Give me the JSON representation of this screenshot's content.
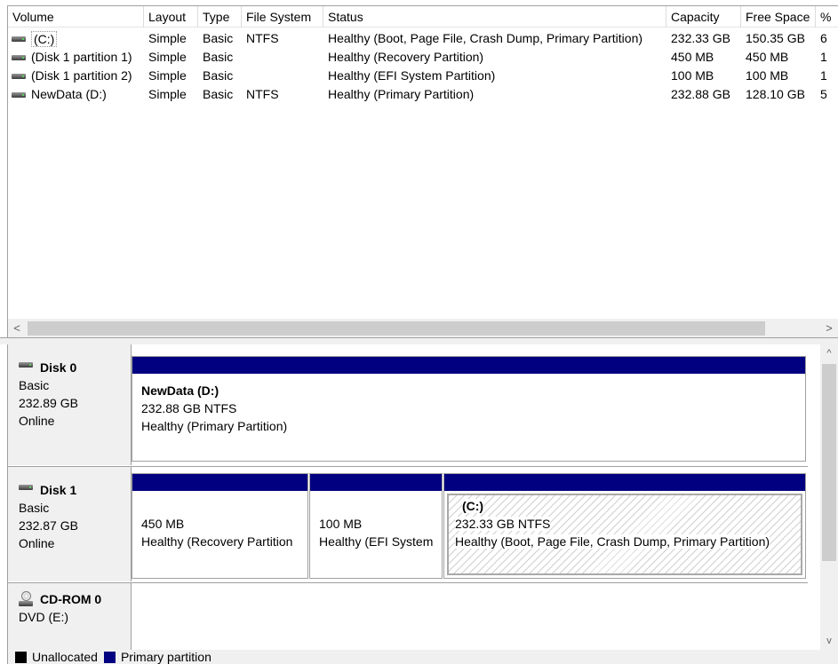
{
  "volume_list": {
    "columns": [
      "Volume",
      "Layout",
      "Type",
      "File System",
      "Status",
      "Capacity",
      "Free Space",
      "%"
    ],
    "rows": [
      {
        "volume": "(C:)",
        "layout": "Simple",
        "type": "Basic",
        "fs": "NTFS",
        "status": "Healthy (Boot, Page File, Crash Dump, Primary Partition)",
        "capacity": "232.33 GB",
        "free": "150.35 GB",
        "pct": "6"
      },
      {
        "volume": "(Disk 1 partition 1)",
        "layout": "Simple",
        "type": "Basic",
        "fs": "",
        "status": "Healthy (Recovery Partition)",
        "capacity": "450 MB",
        "free": "450 MB",
        "pct": "1"
      },
      {
        "volume": "(Disk 1 partition 2)",
        "layout": "Simple",
        "type": "Basic",
        "fs": "",
        "status": "Healthy (EFI System Partition)",
        "capacity": "100 MB",
        "free": "100 MB",
        "pct": "1"
      },
      {
        "volume": "NewData (D:)",
        "layout": "Simple",
        "type": "Basic",
        "fs": "NTFS",
        "status": "Healthy (Primary Partition)",
        "capacity": "232.88 GB",
        "free": "128.10 GB",
        "pct": "5"
      }
    ],
    "scroll_left": "<",
    "scroll_right": ">"
  },
  "disks": [
    {
      "name": "Disk 0",
      "type": "Basic",
      "size": "232.89 GB",
      "state": "Online",
      "partitions": [
        {
          "title": "NewData  (D:)",
          "size_fs": "232.88 GB NTFS",
          "status": "Healthy (Primary Partition)"
        }
      ]
    },
    {
      "name": "Disk 1",
      "type": "Basic",
      "size": "232.87 GB",
      "state": "Online",
      "partitions": [
        {
          "title": "",
          "size_fs": "450 MB",
          "status": "Healthy (Recovery Partition"
        },
        {
          "title": "",
          "size_fs": "100 MB",
          "status": "Healthy (EFI System"
        },
        {
          "title": "(C:)",
          "size_fs": "232.33 GB NTFS",
          "status": "Healthy (Boot, Page File, Crash Dump, Primary Partition)"
        }
      ]
    }
  ],
  "cdrom": {
    "name": "CD-ROM 0",
    "drive": "DVD (E:)"
  },
  "vscroll": {
    "up": "^",
    "down": "v"
  },
  "legend": [
    {
      "label": "Unallocated",
      "color": "#000000"
    },
    {
      "label": "Primary partition",
      "color": "#000080"
    }
  ]
}
